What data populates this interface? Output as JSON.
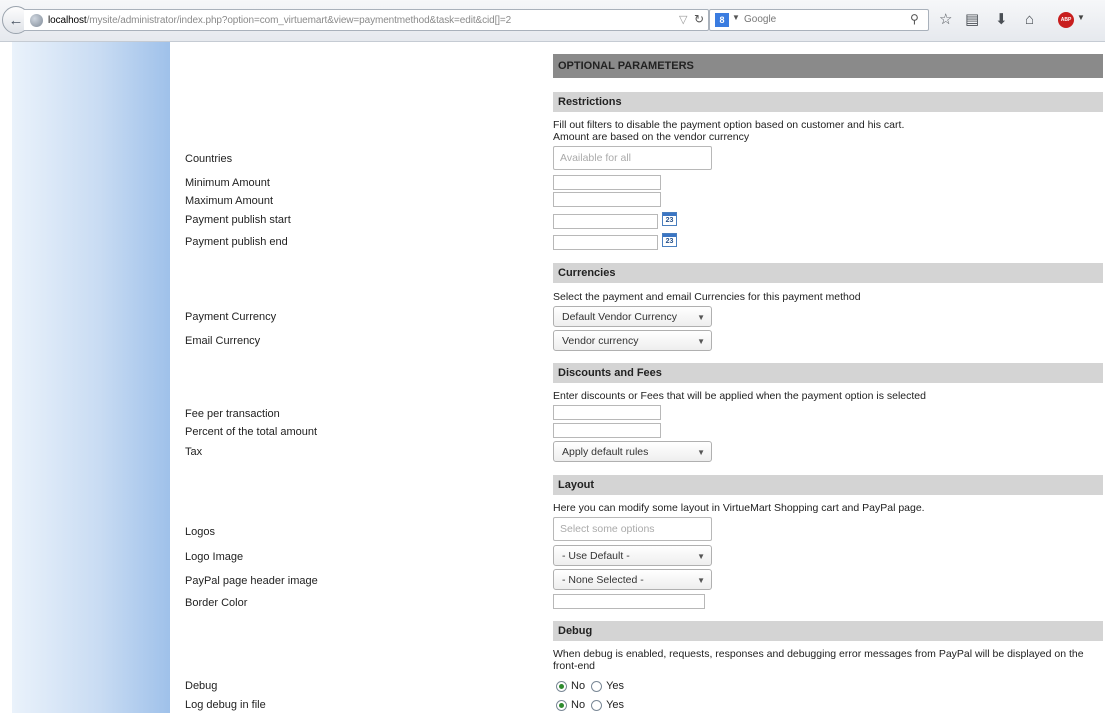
{
  "browser": {
    "url_host": "localhost",
    "url_path": "/mysite/administrator/index.php?option=com_virtuemart&view=paymentmethod&task=edit&cid[]=2",
    "search_placeholder": "Google",
    "search_engine_icon": "8",
    "abp_label": "ABP"
  },
  "sections": {
    "optional": "OPTIONAL PARAMETERS",
    "restrictions": {
      "title": "Restrictions",
      "note": "Fill out filters to disable the payment option based on customer and his cart.\nAmount are based on the vendor currency",
      "countries_label": "Countries",
      "countries_placeholder": "Available for all",
      "min_amount_label": "Minimum Amount",
      "max_amount_label": "Maximum Amount",
      "publish_start_label": "Payment publish start",
      "publish_end_label": "Payment publish end",
      "calendar_day": "23"
    },
    "currencies": {
      "title": "Currencies",
      "note": "Select the payment and email Currencies for this payment method",
      "payment_currency_label": "Payment Currency",
      "payment_currency_value": "Default Vendor Currency",
      "email_currency_label": "Email Currency",
      "email_currency_value": "Vendor currency"
    },
    "discounts": {
      "title": "Discounts and Fees",
      "note": "Enter discounts or Fees that will be applied when the payment option is selected",
      "fee_label": "Fee per transaction",
      "percent_label": "Percent of the total amount",
      "tax_label": "Tax",
      "tax_value": "Apply default rules"
    },
    "layout": {
      "title": "Layout",
      "note": "Here you can modify some layout in VirtueMart Shopping cart and PayPal page.",
      "logos_label": "Logos",
      "logos_placeholder": "Select some options",
      "logo_image_label": "Logo Image",
      "logo_image_value": "- Use Default -",
      "header_image_label": "PayPal page header image",
      "header_image_value": "- None Selected -",
      "border_color_label": "Border Color"
    },
    "debug": {
      "title": "Debug",
      "note": "When debug is enabled, requests, responses and debugging error messages from PayPal will be displayed on the front-end",
      "debug_label": "Debug",
      "log_label": "Log debug in file",
      "no_label": "No",
      "yes_label": "Yes"
    }
  }
}
